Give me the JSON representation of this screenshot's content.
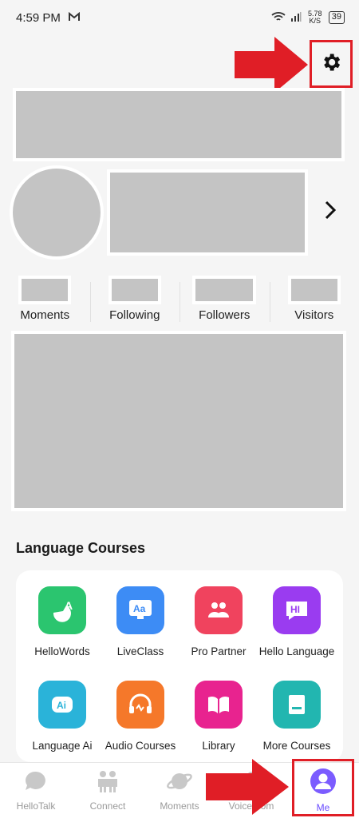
{
  "status_bar": {
    "time": "4:59 PM",
    "network_speed": "5.78 K/S",
    "battery": "39"
  },
  "stats": [
    {
      "label": "Moments"
    },
    {
      "label": "Following"
    },
    {
      "label": "Followers"
    },
    {
      "label": "Visitors"
    }
  ],
  "language_courses": {
    "title": "Language Courses",
    "items": [
      {
        "label": "HelloWords",
        "icon": "hellowords-icon",
        "color": "#2bc56f"
      },
      {
        "label": "LiveClass",
        "icon": "liveclass-icon",
        "color": "#3d8cf5"
      },
      {
        "label": "Pro Partner",
        "icon": "pro-partner-icon",
        "color": "#f0435e"
      },
      {
        "label": "Hello Language",
        "icon": "hello-language-icon",
        "color": "#9a3cf0"
      },
      {
        "label": "Language Ai",
        "icon": "language-ai-icon",
        "color": "#2ab3d9"
      },
      {
        "label": "Audio Courses",
        "icon": "audio-courses-icon",
        "color": "#f5782a"
      },
      {
        "label": "Library",
        "icon": "library-icon",
        "color": "#e8238f"
      },
      {
        "label": "More Courses",
        "icon": "more-courses-icon",
        "color": "#22b6b0"
      }
    ]
  },
  "bottom_nav": [
    {
      "label": "HelloTalk",
      "icon": "chat-bubble-icon"
    },
    {
      "label": "Connect",
      "icon": "people-icon"
    },
    {
      "label": "Moments",
      "icon": "planet-icon"
    },
    {
      "label": "Voiceroom",
      "icon": "voiceroom-icon"
    },
    {
      "label": "Me",
      "icon": "profile-icon",
      "active": true
    }
  ],
  "colors": {
    "accent": "#6a4cff",
    "annotation": "#e01e26"
  }
}
